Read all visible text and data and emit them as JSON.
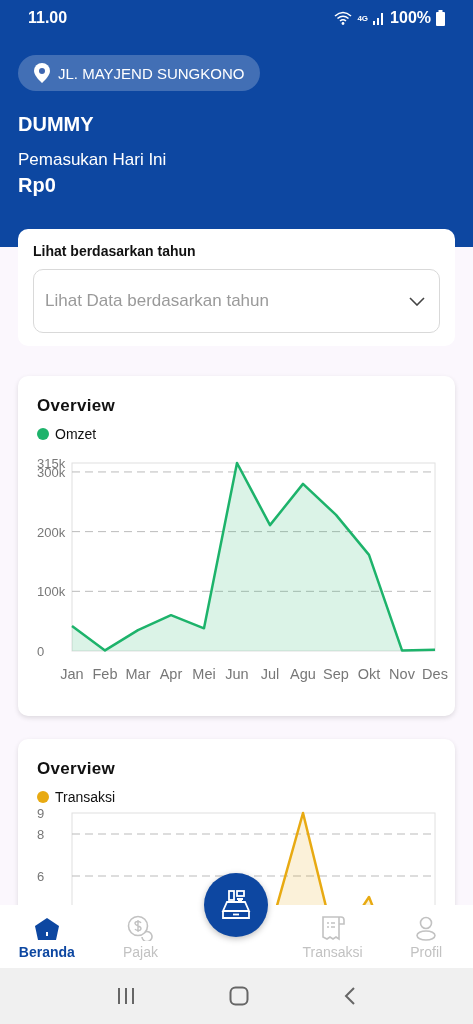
{
  "status_bar": {
    "time": "11.00",
    "network": "4G",
    "battery": "100%"
  },
  "header": {
    "location": "JL. MAYJEND SUNGKONO",
    "store_name": "DUMMY",
    "income_label": "Pemasukan Hari Ini",
    "income_value": "Rp0"
  },
  "filter": {
    "label": "Lihat berdasarkan tahun",
    "placeholder": "Lihat Data berdasarkan tahun"
  },
  "revenue_card": {
    "chart_data": {
      "type": "area",
      "title": "Overview",
      "categories": [
        "Jan",
        "Feb",
        "Mar",
        "Apr",
        "Mei",
        "Jun",
        "Jul",
        "Agu",
        "Sep",
        "Okt",
        "Nov",
        "Des"
      ],
      "series": [
        {
          "name": "Omzet",
          "color": "#1db36b",
          "values": [
            42000,
            1000,
            35000,
            60000,
            38000,
            315000,
            211000,
            280000,
            228000,
            161000,
            1000,
            2000
          ]
        }
      ],
      "ylim": [
        0,
        315000
      ],
      "grid": true,
      "yticks": [
        {
          "value": 0,
          "label": "0"
        },
        {
          "value": 100000,
          "label": "100k"
        },
        {
          "value": 200000,
          "label": "200k"
        },
        {
          "value": 300000,
          "label": "300k"
        },
        {
          "value": 315000,
          "label": "315k"
        }
      ]
    }
  },
  "transactions_card": {
    "title": "Overview",
    "legend": {
      "name": "Transaksi",
      "color": "#e8aa12"
    },
    "y_tick_labels": [
      "9",
      "8",
      "6"
    ]
  },
  "bottom_nav": {
    "items": [
      {
        "label": "Beranda",
        "kind": "home",
        "selected": true
      },
      {
        "label": "Pajak",
        "kind": "tax",
        "selected": false
      },
      {
        "label": "Transaksi",
        "kind": "receipt",
        "selected": false
      },
      {
        "label": "Profil",
        "kind": "profile",
        "selected": false
      }
    ]
  }
}
